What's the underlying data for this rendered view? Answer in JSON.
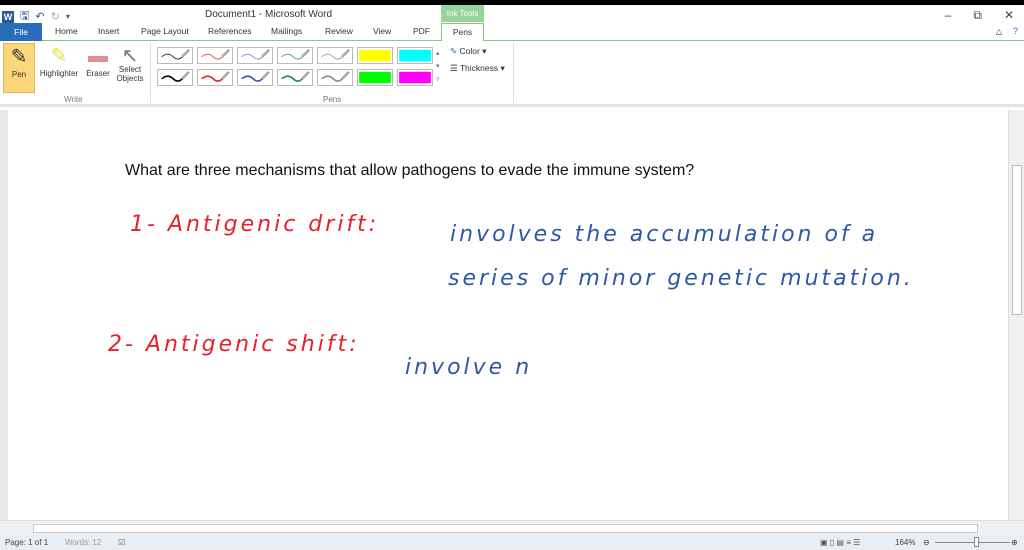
{
  "window": {
    "title": "Document1  -  Microsoft Word",
    "contextual_tab": "Ink Tools"
  },
  "tabs": [
    "File",
    "Home",
    "Insert",
    "Page Layout",
    "References",
    "Mailings",
    "Review",
    "View",
    "PDF",
    "Pens"
  ],
  "ribbon": {
    "write": {
      "label": "Write",
      "buttons": [
        "Pen",
        "Highlighter",
        "Eraser",
        "Select Objects"
      ]
    },
    "pens": {
      "label": "Pens",
      "colors_row1": [
        "#222222",
        "#e8404a",
        "#6a8fc0",
        "#4a9a6a",
        "#999999",
        "#ffff00",
        "#00ffff"
      ],
      "colors_row2": [
        "#000000",
        "#e8202a",
        "#2d58a8",
        "#1a8a4a",
        "#888888",
        "#00ff00",
        "#ff00ff"
      ]
    },
    "color_label": "Color",
    "thickness_label": "Thickness"
  },
  "document": {
    "question": "What are three mechanisms that allow pathogens to evade the immune system?",
    "ink": {
      "line1_red": "1- Antigenic drift:",
      "line1_blue": "involves the  accumulation of a",
      "line2_blue": "series  of   minor genetic mutation.",
      "line3_red": "2- Antigenic shift:",
      "line3_blue": "involve    n"
    }
  },
  "status": {
    "page": "Page: 1 of 1",
    "words": "Words: 12",
    "zoom": "164%"
  }
}
